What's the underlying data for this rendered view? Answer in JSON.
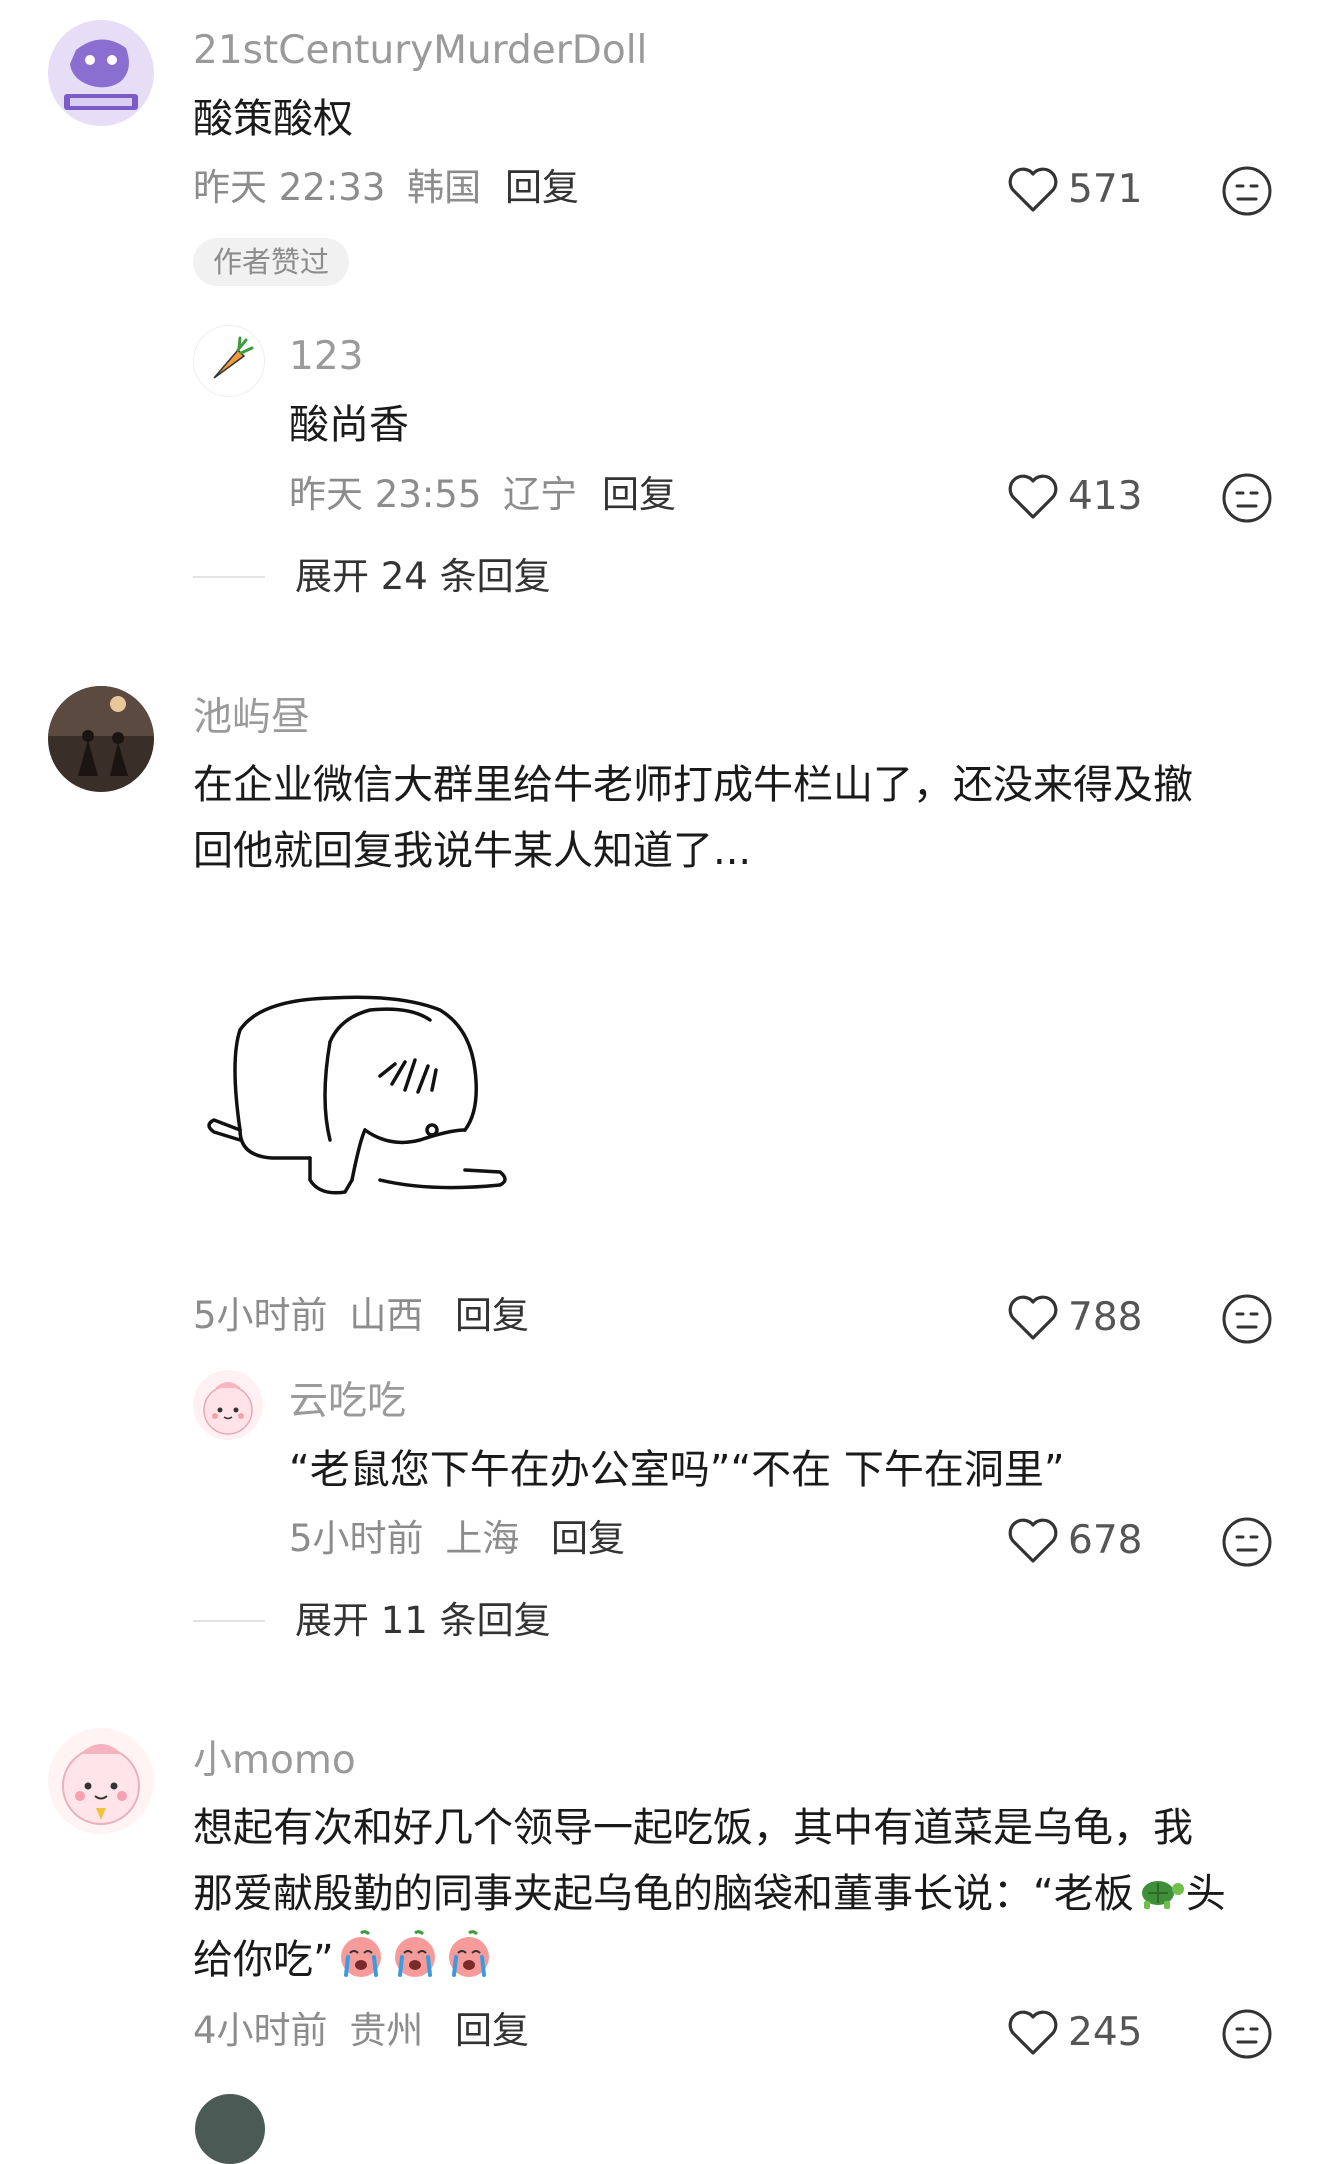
{
  "comments": [
    {
      "username": "21stCenturyMurderDoll",
      "text": "酸策酸权",
      "time": "昨天 22:33",
      "location": "韩国",
      "reply_label": "回复",
      "likes": "571",
      "badge": "作者赞过",
      "replies": [
        {
          "username": "123",
          "text": "酸尚香",
          "time": "昨天 23:55",
          "location": "辽宁",
          "reply_label": "回复",
          "likes": "413"
        }
      ],
      "expand_label": "展开 24 条回复"
    },
    {
      "username": "池屿昼",
      "text_lines": [
        "在企业微信大群里给牛老师打成牛栏山了，还没来得及撤",
        "回他就回复我说牛某人知道了..."
      ],
      "time": "5小时前",
      "location": "山西",
      "reply_label": "回复",
      "likes": "788",
      "replies": [
        {
          "username": "云吃吃",
          "text": "“老鼠您下午在办公室吗”“不在 下午在洞里”",
          "time": "5小时前",
          "location": "上海",
          "reply_label": "回复",
          "likes": "678"
        }
      ],
      "expand_label": "展开 11 条回复"
    },
    {
      "username": "小momo",
      "text_lines": [
        "想起有次和好几个领导一起吃饭，其中有道菜是乌龟，我",
        "那爱献殷勤的同事夹起乌龟的脑袋和董事长说：“老板",
        "头",
        "给你吃”"
      ],
      "time": "4小时前",
      "location": "贵州",
      "reply_label": "回复",
      "likes": "245"
    }
  ],
  "icons": {
    "like": "heart-outline-icon",
    "dislike": "meh-face-icon",
    "turtle": "turtle-emoji",
    "crying": "crying-face-emoji"
  },
  "colors": {
    "username": "#9a9a9a",
    "meta": "#8c8c8c",
    "text": "#1a1a1a",
    "badge_bg": "#f1f1f1"
  }
}
